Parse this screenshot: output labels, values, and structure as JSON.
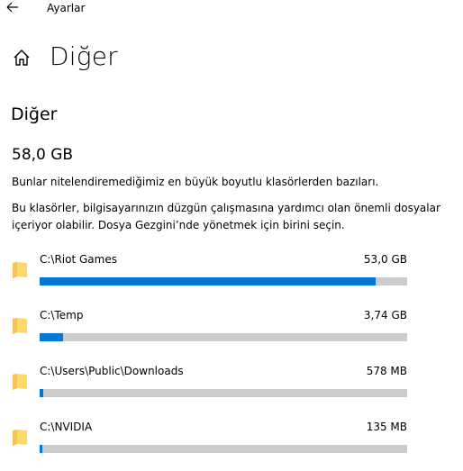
{
  "window": {
    "app_title": "Ayarlar"
  },
  "header": {
    "page_title": "Diğer"
  },
  "section": {
    "title": "Diğer",
    "total_size": "58,0 GB",
    "description_1": "Bunlar nitelendiremediğimiz en büyük boyutlu klasörlerden bazıları.",
    "description_2": "Bu klasörler, bilgisayarınızın düzgün çalışmasına yardımcı olan önemli dosyalar içeriyor olabilir. Dosya Gezgini’nde yönetmek için birini seçin."
  },
  "folders": [
    {
      "path": "C:\\Riot Games",
      "size": "53,0 GB",
      "fraction": 0.913
    },
    {
      "path": "C:\\Temp",
      "size": "3,74 GB",
      "fraction": 0.064
    },
    {
      "path": "C:\\Users\\Public\\Downloads",
      "size": "578 MB",
      "fraction": 0.01
    },
    {
      "path": "C:\\NVIDIA",
      "size": "135 MB",
      "fraction": 0.0075
    }
  ],
  "colors": {
    "accent": "#0078d7",
    "bar_track": "#cccccc",
    "folder_light": "#ffd968",
    "folder_dark": "#e8b84a"
  },
  "icons": {
    "back": "arrow-left-icon",
    "home": "home-icon",
    "folder": "folder-icon"
  }
}
